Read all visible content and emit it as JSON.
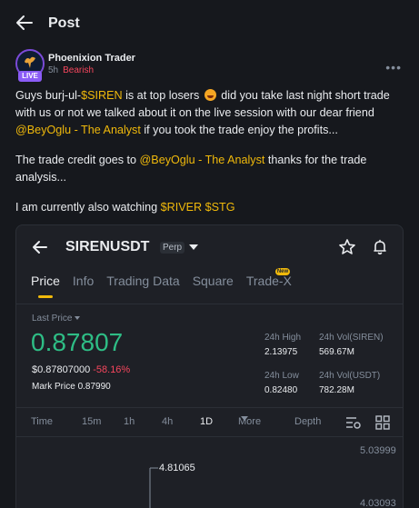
{
  "header": {
    "title": "Post",
    "back_icon": "arrow-left-icon"
  },
  "author": {
    "name": "Phoenixion Trader",
    "time": "5h",
    "sentiment": "Bearish",
    "live": "LIVE",
    "more_icon": "more-dots-icon"
  },
  "post": {
    "line1_a": "Guys burj-ul-",
    "line1_tag": "$SIREN",
    "line1_b": " is at top losers ",
    "line1_c": " did you take last night short trade with us or not we talked about it on the live session with our dear friend ",
    "line1_mention": "@BeyOglu - The Analyst",
    "line1_d": "  if you took the trade enjoy the profits...",
    "line2_a": "The trade credit goes to ",
    "line2_mention": "@BeyOglu - The Analyst",
    "line2_b": "  thanks for the trade analysis...",
    "line3_a": "I am currently also watching ",
    "line3_tag1": "$RIVER",
    "line3_tag2": "$STG"
  },
  "card": {
    "pair": "SIRENUSDT",
    "contract": "Perp",
    "tabs": [
      "Price",
      "Info",
      "Trading Data",
      "Square",
      "Trade-X"
    ],
    "new_badge": "New",
    "last_price_label": "Last Price",
    "last_price": "0.87807",
    "usd_price": "$0.87807000",
    "change": "-58.16%",
    "mark_label": "Mark Price",
    "mark_price": "0.87990",
    "stats": {
      "high_label": "24h High",
      "high": "2.13975",
      "vol_siren_label": "24h Vol(SIREN)",
      "vol_siren": "569.67M",
      "low_label": "24h Low",
      "low": "0.82480",
      "vol_usdt_label": "24h Vol(USDT)",
      "vol_usdt": "782.28M"
    },
    "timeframes": [
      "Time",
      "15m",
      "1h",
      "4h",
      "1D",
      "More",
      "Depth"
    ],
    "active_timeframe": "1D",
    "chart": {
      "y_top": "5.03999",
      "y_mid": "4.03093",
      "high_marker": "4.81065"
    }
  },
  "colors": {
    "accent": "#f0b90b",
    "up": "#2ebd85",
    "down": "#f6465d"
  }
}
